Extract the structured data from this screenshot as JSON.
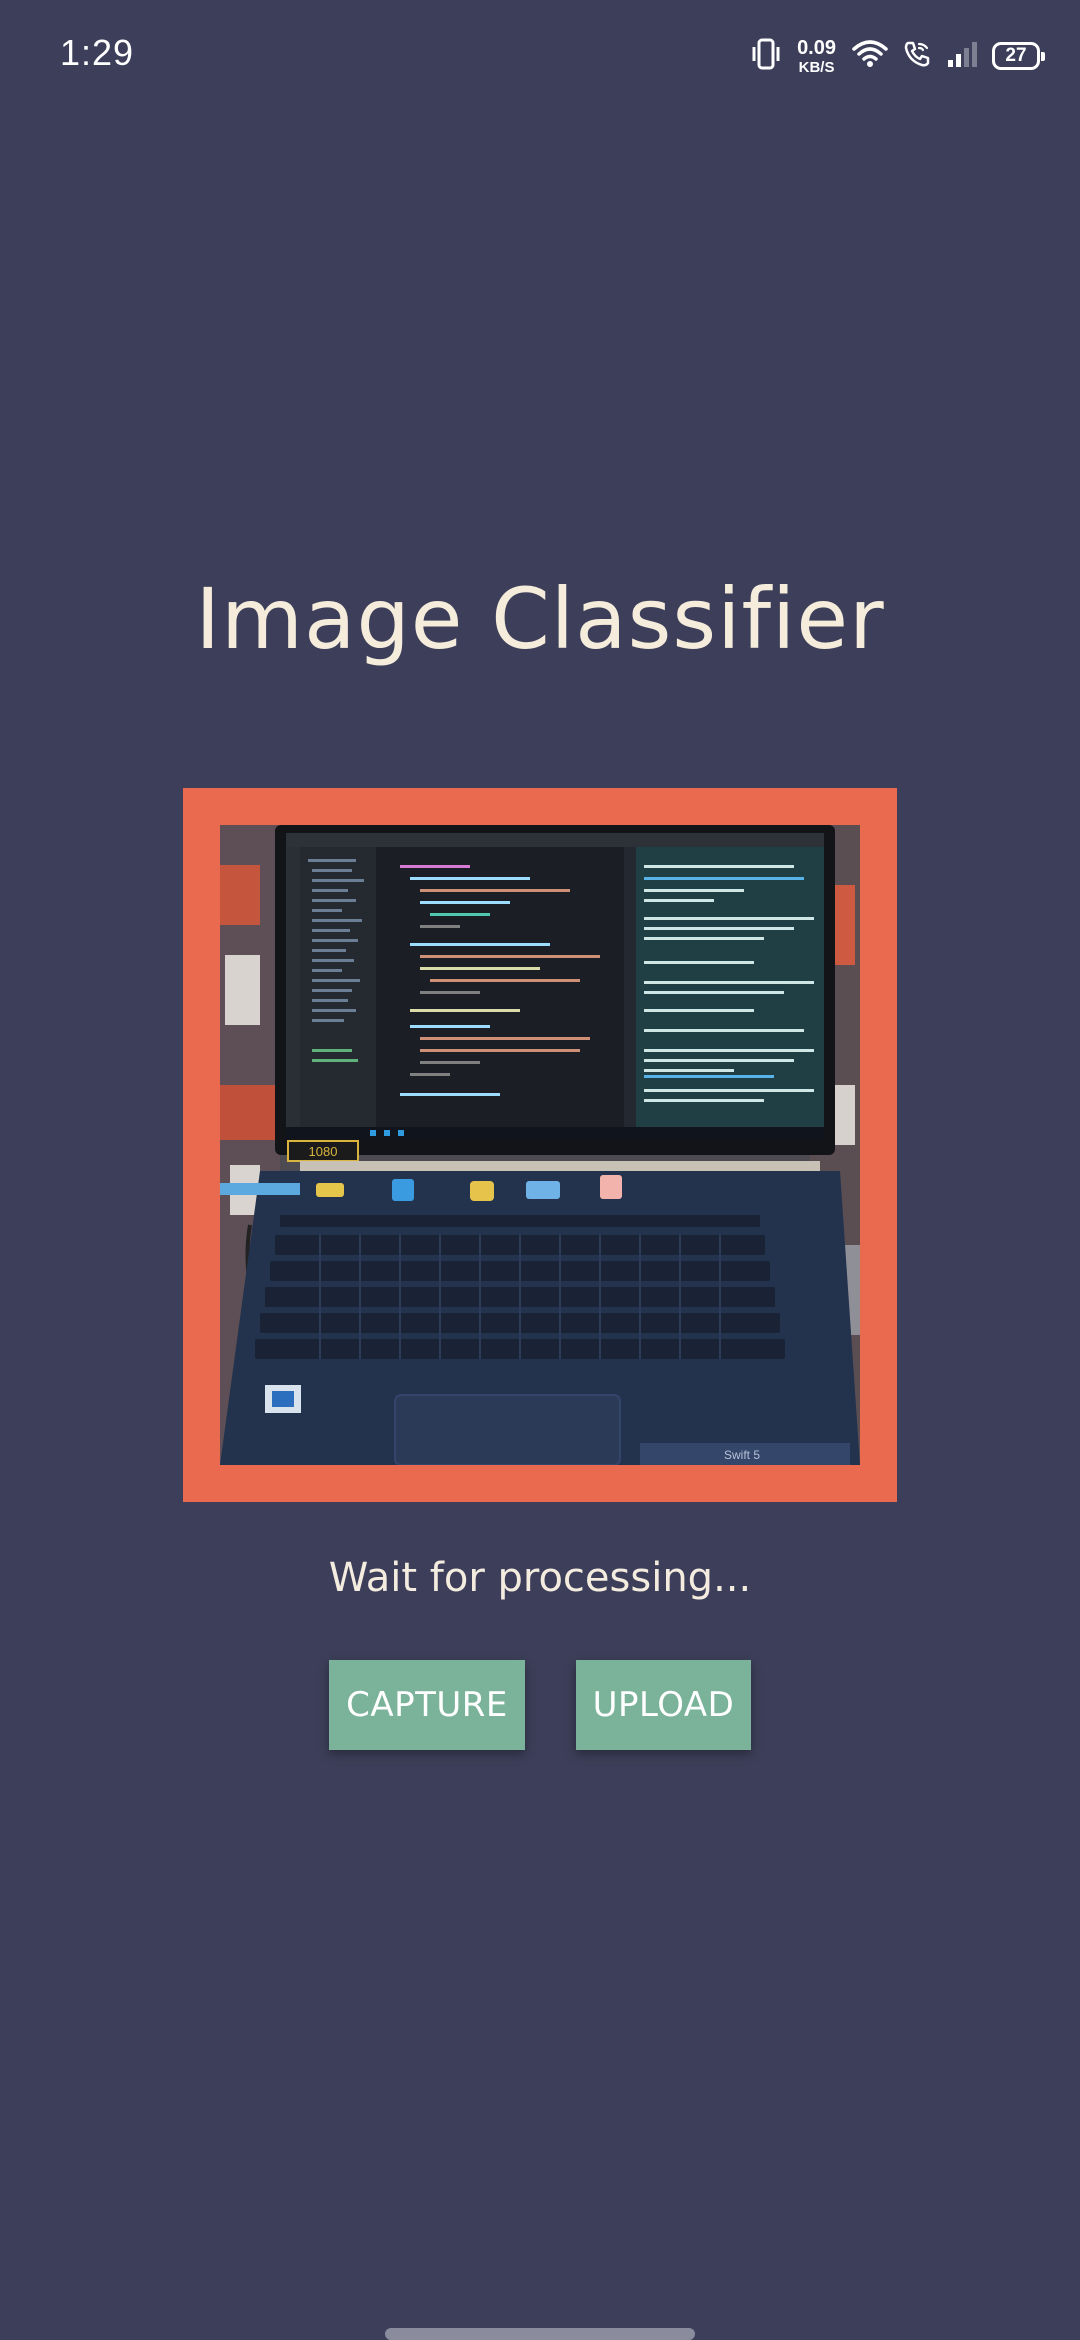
{
  "status_bar": {
    "time": "1:29",
    "net_speed_value": "0.09",
    "net_speed_unit": "KB/S",
    "battery_level": "27",
    "icons": [
      "vibrate-icon",
      "wifi-icon",
      "wifi-call-icon",
      "signal-icon",
      "battery-icon"
    ]
  },
  "app": {
    "title": "Image Classifier",
    "status_message": "Wait for processing...",
    "capture_label": "CAPTURE",
    "upload_label": "UPLOAD"
  },
  "photo": {
    "subject": "laptop-photo",
    "screen_text": "1080",
    "trackpad_text": "Swift 5"
  },
  "colors": {
    "background": "#3d3f5a",
    "title": "#f5ecdc",
    "frame_border": "#ea6a4f",
    "button": "#7ab39a"
  }
}
